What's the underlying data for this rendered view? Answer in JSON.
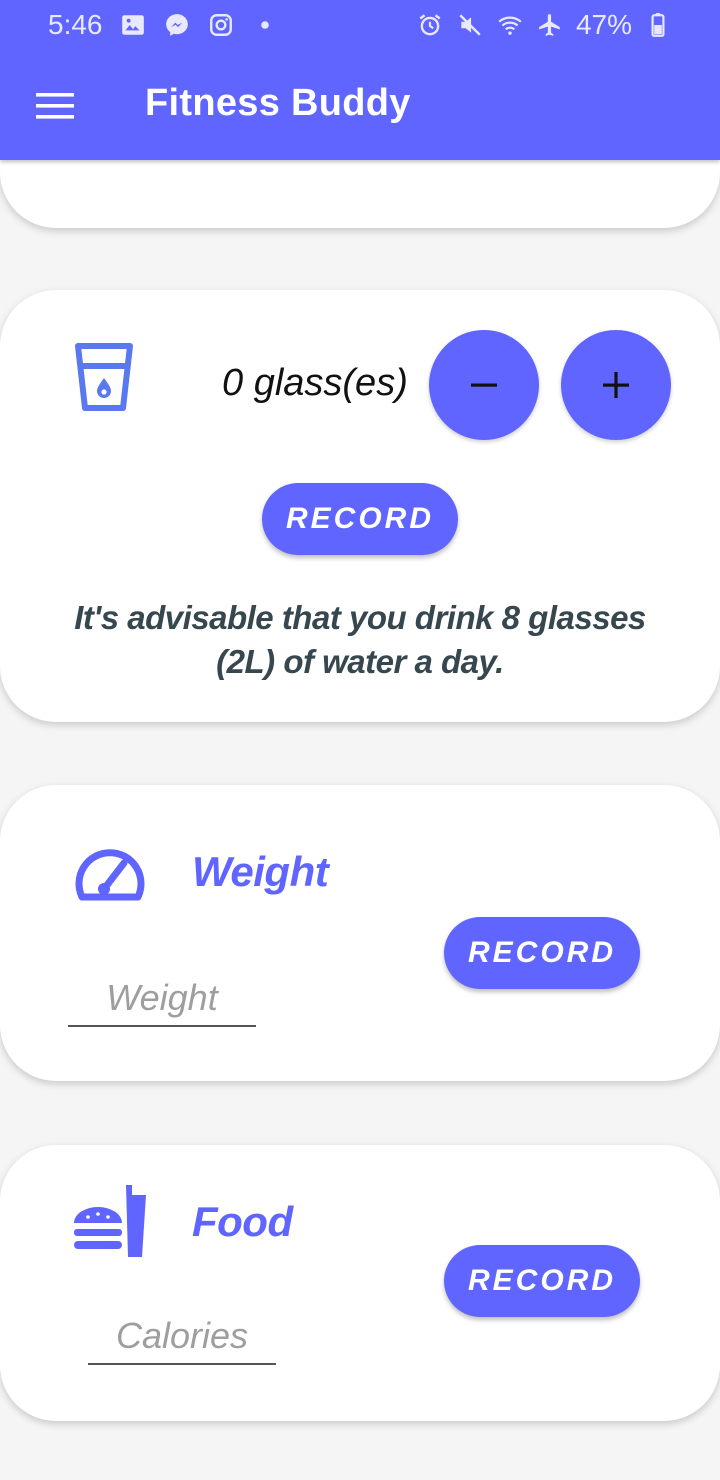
{
  "status_bar": {
    "time": "5:46",
    "battery": "47%",
    "left_icons": [
      "gallery-icon",
      "messenger-icon",
      "instagram-icon",
      "dot-icon"
    ],
    "right_icons": [
      "alarm-icon",
      "mute-icon",
      "wifi-icon",
      "airplane-icon",
      "battery-icon"
    ]
  },
  "header": {
    "title": "Fitness Buddy",
    "menu_icon": "hamburger-menu-icon"
  },
  "colors": {
    "primary": "#5f65fe",
    "text_dark": "#37474f",
    "card_bg": "#ffffff"
  },
  "water_card": {
    "icon": "water-glass-icon",
    "count_label": "0 glass(es)",
    "minus_label": "−",
    "plus_label": "+",
    "record_label": "RECORD",
    "advice": "It's advisable that you drink 8 glasses (2L) of water a day."
  },
  "weight_card": {
    "icon": "speedometer-icon",
    "title": "Weight",
    "input_placeholder": "Weight",
    "input_value": "",
    "record_label": "RECORD"
  },
  "food_card": {
    "icon": "fastfood-icon",
    "title": "Food",
    "input_placeholder": "Calories",
    "input_value": "",
    "record_label": "RECORD"
  }
}
